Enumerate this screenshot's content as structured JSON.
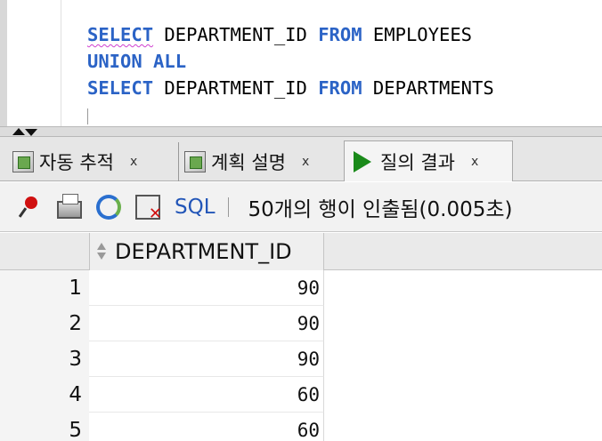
{
  "editor": {
    "lines": [
      [
        {
          "t": "SELECT",
          "kw": true,
          "sq": true
        },
        {
          "t": " DEPARTMENT_ID "
        },
        {
          "t": "FROM",
          "kw": true
        },
        {
          "t": " EMPLOYEES"
        }
      ],
      [
        {
          "t": "UNION ALL",
          "kw": true
        }
      ],
      [
        {
          "t": "SELECT",
          "kw": true
        },
        {
          "t": " DEPARTMENT_ID "
        },
        {
          "t": "FROM",
          "kw": true
        },
        {
          "t": " DEPARTMENTS"
        }
      ]
    ]
  },
  "tabs": [
    {
      "label": "자동 추적",
      "close": "x"
    },
    {
      "label": "계획 설명",
      "close": "x"
    },
    {
      "label": "질의 결과",
      "close": "x",
      "active": true
    }
  ],
  "toolbar": {
    "sql_label": "SQL",
    "status": "50개의 행이 인출됨(0.005초)"
  },
  "grid": {
    "column": "DEPARTMENT_ID",
    "rows": [
      {
        "num": "1",
        "value": "90"
      },
      {
        "num": "2",
        "value": "90"
      },
      {
        "num": "3",
        "value": "90"
      },
      {
        "num": "4",
        "value": "60"
      },
      {
        "num": "5",
        "value": "60"
      }
    ]
  },
  "colors": {
    "keyword": "#2b63c6",
    "sql_link": "#2356b8",
    "run_icon": "#1a8a1a"
  }
}
